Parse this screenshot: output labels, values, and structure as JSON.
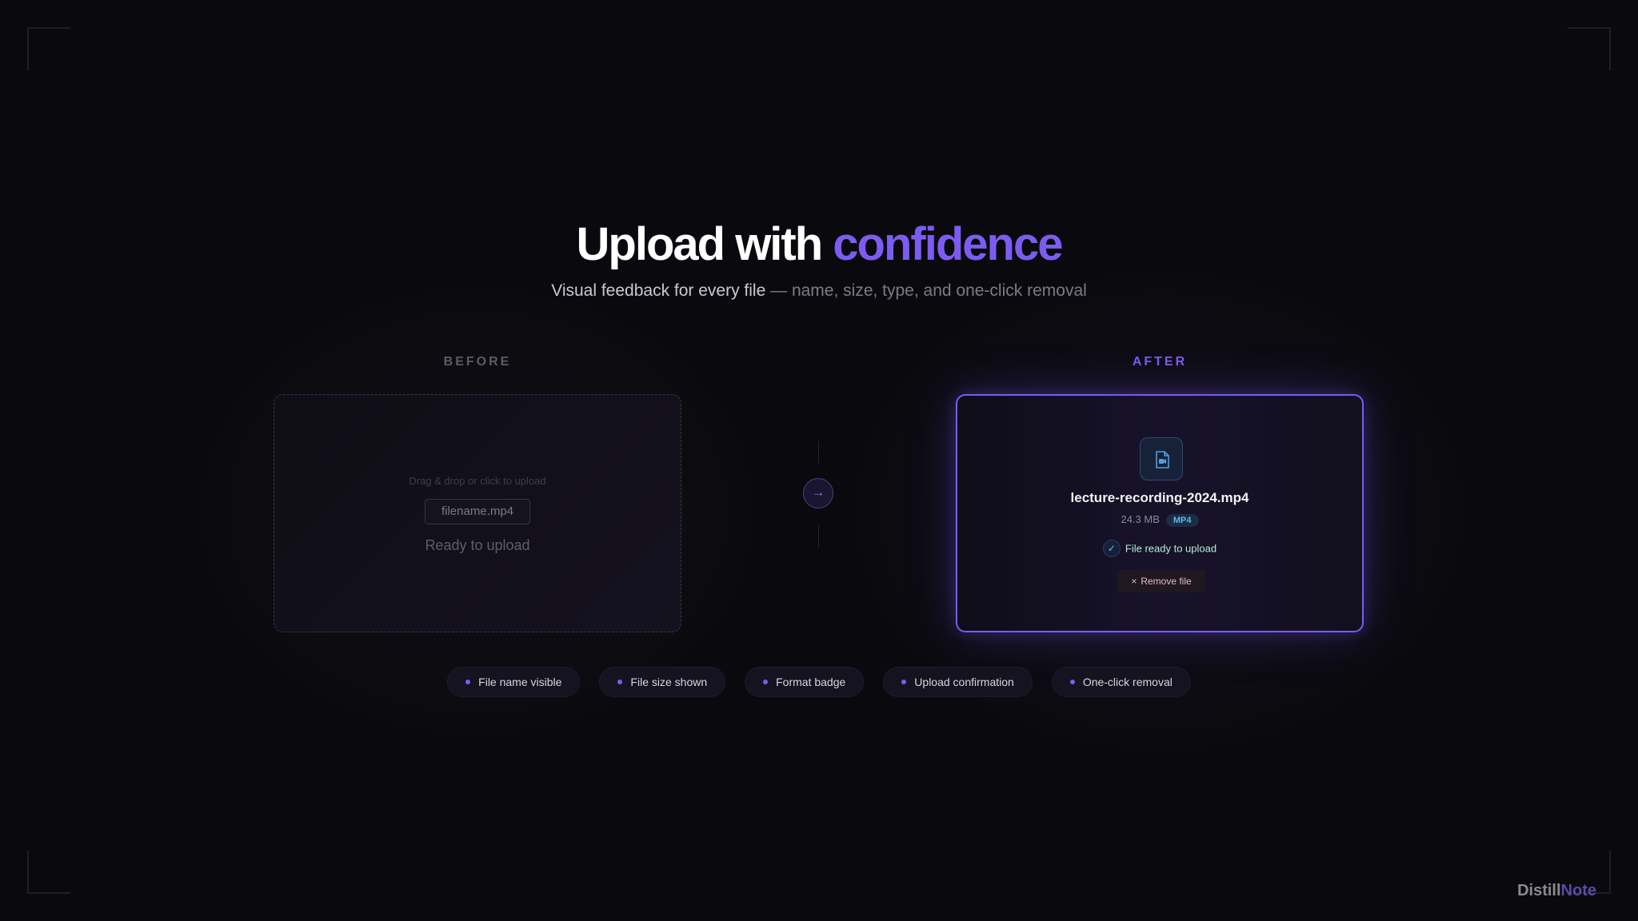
{
  "headline": {
    "part1": "Upload with ",
    "accent": "confidence"
  },
  "subheadline": {
    "strong": "Visual feedback for every file",
    "rest": " — name, size, type, and one-click removal"
  },
  "before": {
    "label": "BEFORE",
    "hint": "Drag & drop or click to upload",
    "filename": "filename.mp4",
    "status": "Ready to upload"
  },
  "connector": {
    "arrow_icon": "arrow-right-icon",
    "glyph": "→"
  },
  "after": {
    "label": "AFTER",
    "file_icon": "video-file-icon",
    "filename": "lecture-recording-2024.mp4",
    "size": "24.3 MB",
    "format_badge": "MP4",
    "status": "File ready to upload",
    "check_glyph": "✓",
    "remove_glyph": "×",
    "remove_label": "Remove file"
  },
  "features": [
    "File name visible",
    "File size shown",
    "Format badge",
    "Upload confirmation",
    "One-click removal"
  ],
  "brand": {
    "part1": "Distill",
    "part2": "Note"
  },
  "colors": {
    "accent": "#7c5cf0",
    "background": "#0a0a0e",
    "badge_text": "#5fb8e8",
    "status_text": "#b7ecd6"
  }
}
